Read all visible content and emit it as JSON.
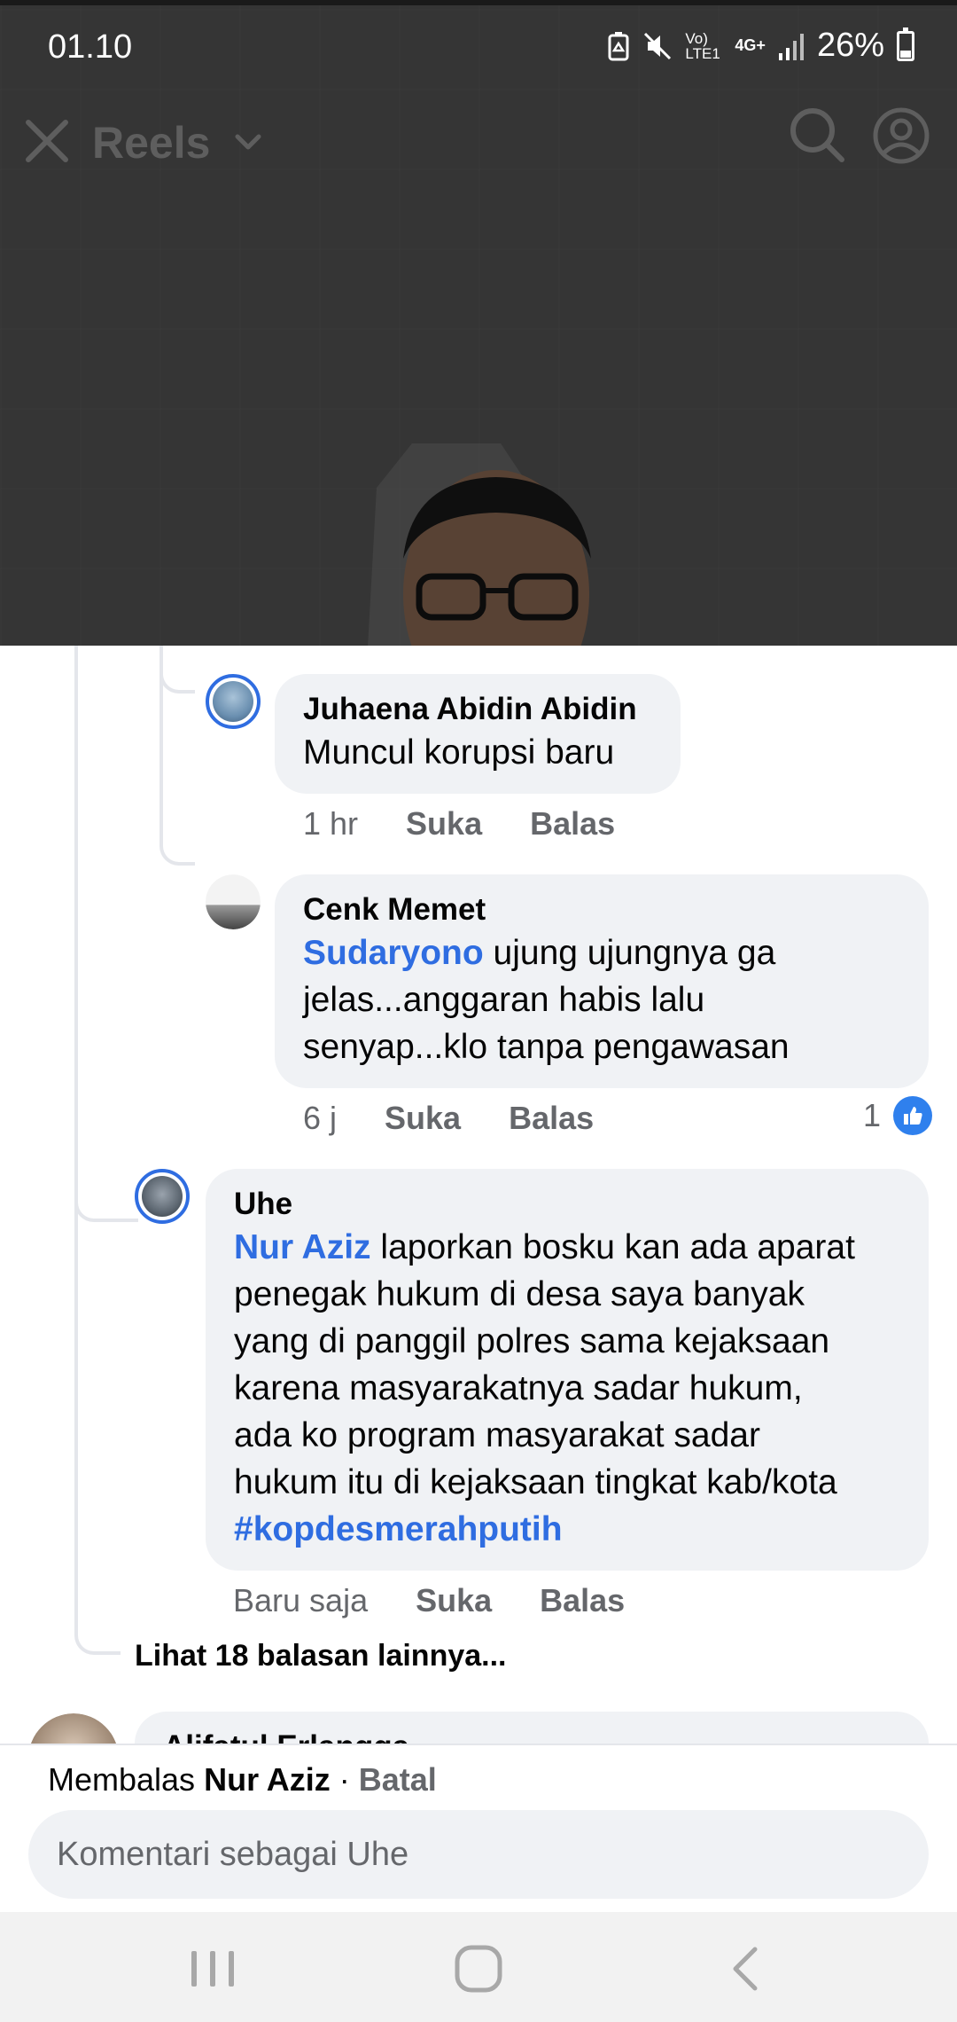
{
  "status_bar": {
    "time": "01.10",
    "battery": "26%",
    "network": "Vo) LTE1",
    "network_type": "4G+",
    "icons": [
      "battery-saver-icon",
      "mute-icon",
      "volte-icon",
      "4g-icon",
      "signal-icon",
      "battery-icon"
    ]
  },
  "header": {
    "title": "Reels",
    "icons": [
      "close-icon",
      "chevron-down-icon",
      "search-icon",
      "profile-icon"
    ]
  },
  "comments": [
    {
      "author": "Juhaena Abidin Abidin",
      "text": "Muncul korupsi baru",
      "time": "1 hr",
      "like_label": "Suka",
      "reply_label": "Balas"
    },
    {
      "author": "Cenk Memet",
      "mention": "Sudaryono",
      "text_line1": " ujung ujungnya ga",
      "text_line2": "jelas...anggaran habis lalu",
      "text_line3": "senyap...klo tanpa pengawasan",
      "time": "6 j",
      "like_label": "Suka",
      "reply_label": "Balas",
      "reaction_count": "1"
    },
    {
      "author": "Uhe",
      "mention": "Nur Aziz",
      "text_line1": " laporkan bosku kan ada aparat",
      "text_line2": "penegak hukum di desa saya banyak",
      "text_line3": "yang di panggil polres sama kejaksaan",
      "text_line4": "karena masyarakatnya sadar hukum,",
      "text_line5": "ada ko program masyarakat sadar",
      "text_line6": "hukum itu di kejaksaan tingkat kab/kota",
      "hashtag": "#kopdesmerahputih",
      "time": "Baru saja",
      "like_label": "Suka",
      "reply_label": "Balas"
    }
  ],
  "more_replies": "Lihat 18 balasan lainnya...",
  "next_comment_author": "Alifatul Erlangga",
  "reply_box": {
    "prefix": "Membalas",
    "target": "Nur Aziz",
    "separator": " · ",
    "cancel": "Batal",
    "placeholder": "Komentari sebagai Uhe"
  },
  "nav": {
    "icons": [
      "recent-apps-icon",
      "home-icon",
      "back-icon"
    ]
  },
  "colors": {
    "link": "#2f6de1",
    "bubble": "#f0f2f5",
    "meta": "#65676b",
    "like": "#2f80ed"
  }
}
